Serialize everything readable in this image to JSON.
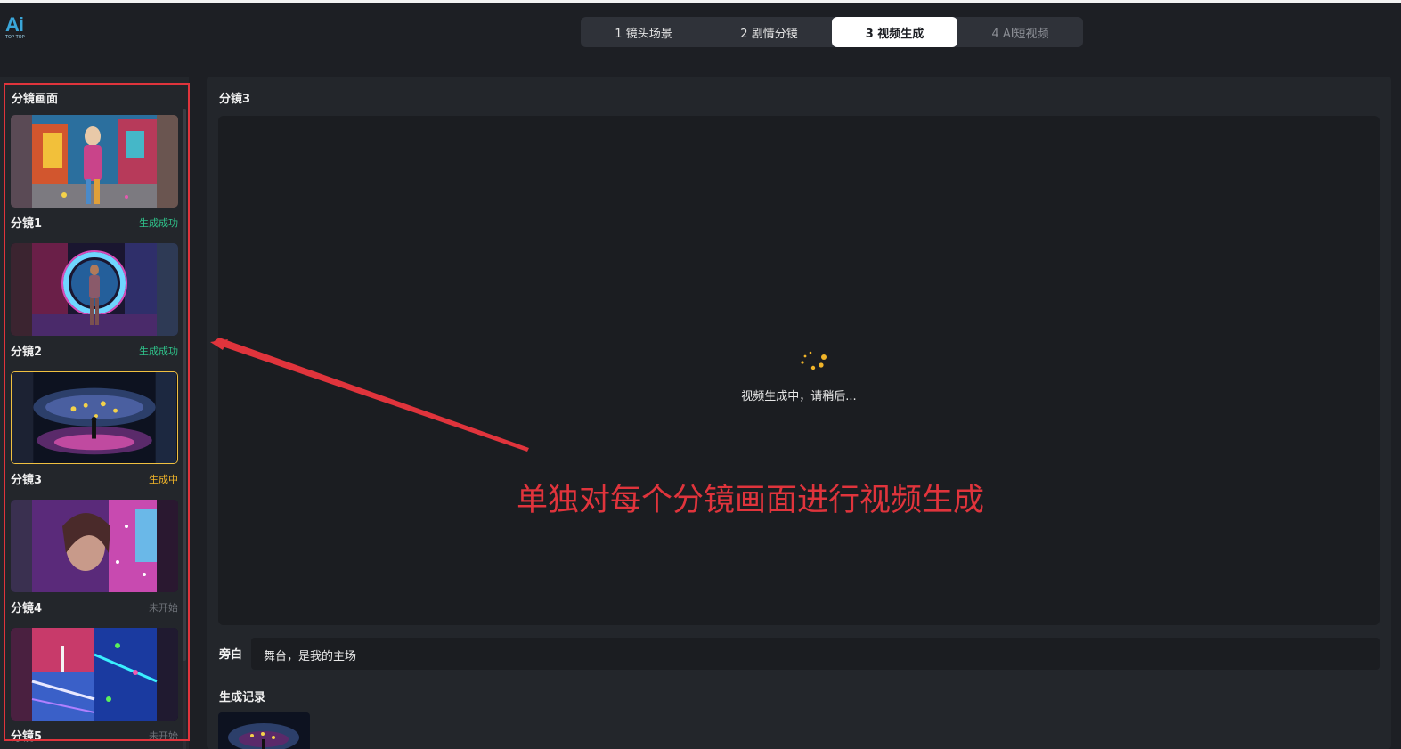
{
  "header": {
    "logo": {
      "mark": "Ai",
      "sub": "TOP TOP"
    },
    "steps": [
      {
        "label": "1 镜头场景",
        "state": "normal"
      },
      {
        "label": "2 剧情分镜",
        "state": "normal"
      },
      {
        "label": "3 视频生成",
        "state": "active"
      },
      {
        "label": "4 AI短视频",
        "state": "disabled"
      }
    ]
  },
  "sidebar": {
    "title": "分镜画面",
    "shots": [
      {
        "label": "分镜1",
        "status": "生成成功",
        "status_type": "success"
      },
      {
        "label": "分镜2",
        "status": "生成成功",
        "status_type": "success"
      },
      {
        "label": "分镜3",
        "status": "生成中",
        "status_type": "running"
      },
      {
        "label": "分镜4",
        "status": "未开始",
        "status_type": "idle"
      },
      {
        "label": "分镜5",
        "status": "未开始",
        "status_type": "idle"
      }
    ]
  },
  "main": {
    "title": "分镜3",
    "loading_text": "视频生成中，请稍后...",
    "narration_label": "旁白",
    "narration_value": "舞台，是我的主场",
    "history_title": "生成记录"
  },
  "annotation": {
    "text": "单独对每个分镜画面进行视频生成",
    "color": "#e0343c"
  },
  "colors": {
    "success": "#2fc28a",
    "running": "#f0b429",
    "idle": "#6f737a",
    "accent_red": "#e0343c"
  }
}
